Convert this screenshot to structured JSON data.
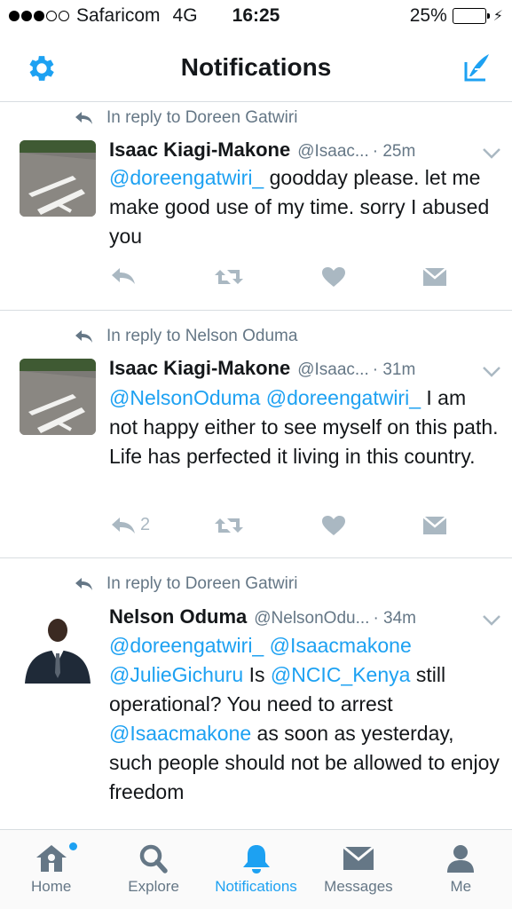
{
  "status_bar": {
    "carrier": "Safaricom",
    "network": "4G",
    "time": "16:25",
    "battery": "25%",
    "battery_level": 0.25,
    "signal_bars_filled": 3,
    "signal_bars_total": 5
  },
  "nav": {
    "title": "Notifications",
    "left_icon": "gear-icon",
    "right_icon": "compose-icon"
  },
  "colors": {
    "accent": "#1da1f2",
    "text": "#14171a",
    "muted": "#657786",
    "action_gray": "#aab8c2"
  },
  "tweets": [
    {
      "reply_context": "In reply to Doreen Gatwiri",
      "name": "Isaac Kiagi-Makone",
      "handle": "@Isaac...",
      "time": "· 25m",
      "text_parts": [
        {
          "t": "@doreengatwiri_",
          "mention": true
        },
        {
          "t": " goodday please. let me make good use of my time. sorry I abused you",
          "mention": false
        }
      ],
      "reply_count": ""
    },
    {
      "reply_context": "In reply to Nelson Oduma",
      "name": "Isaac Kiagi-Makone",
      "handle": "@Isaac...",
      "time": "· 31m",
      "text_parts": [
        {
          "t": "@NelsonOduma",
          "mention": true
        },
        {
          "t": " ",
          "mention": false
        },
        {
          "t": "@doreengatwiri_",
          "mention": true
        },
        {
          "t": " I am not happy either to see myself on this path. Life has perfected it living in this country.",
          "mention": false
        }
      ],
      "reply_count": "2"
    },
    {
      "reply_context": "In reply to Doreen Gatwiri",
      "name": "Nelson Oduma",
      "handle": "@NelsonOdu...",
      "time": "· 34m",
      "text_parts": [
        {
          "t": "@doreengatwiri_",
          "mention": true
        },
        {
          "t": " ",
          "mention": false
        },
        {
          "t": "@Isaacmakone",
          "mention": true
        },
        {
          "t": " ",
          "mention": false
        },
        {
          "t": "@JulieGichuru",
          "mention": true
        },
        {
          "t": " Is ",
          "mention": false
        },
        {
          "t": "@NCIC_Kenya",
          "mention": true
        },
        {
          "t": " still operational?  You need to arrest ",
          "mention": false
        },
        {
          "t": "@Isaacmakone",
          "mention": true
        },
        {
          "t": " as soon as yesterday,  such people should not be allowed to enjoy freedom",
          "mention": false
        }
      ],
      "reply_count": ""
    }
  ],
  "tabs": [
    {
      "label": "Home",
      "icon": "home-icon",
      "active": false,
      "has_dot": true
    },
    {
      "label": "Explore",
      "icon": "search-icon",
      "active": false,
      "has_dot": false
    },
    {
      "label": "Notifications",
      "icon": "bell-icon",
      "active": true,
      "has_dot": false
    },
    {
      "label": "Messages",
      "icon": "envelope-icon",
      "active": false,
      "has_dot": false
    },
    {
      "label": "Me",
      "icon": "person-icon",
      "active": false,
      "has_dot": false
    }
  ]
}
